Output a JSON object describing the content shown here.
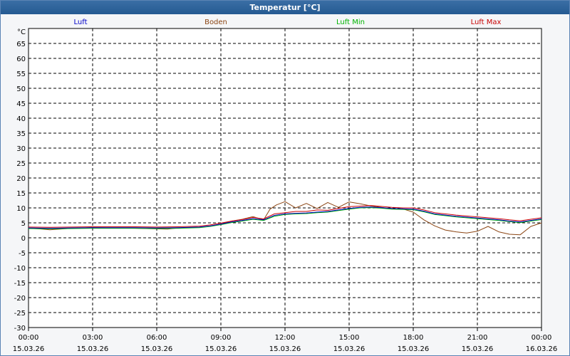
{
  "window": {
    "title": "Temperatur [°C]"
  },
  "chart_data": {
    "type": "line",
    "title": "Temperatur [°C]",
    "ylabel": "°C",
    "ylim": [
      -30,
      70
    ],
    "yticks": [
      65,
      60,
      55,
      50,
      45,
      40,
      35,
      30,
      25,
      20,
      15,
      10,
      5,
      0,
      -5,
      -10,
      -15,
      -20,
      -25,
      -30
    ],
    "xlim_hours": [
      0,
      24
    ],
    "xticks": [
      {
        "time": "00:00",
        "date": "15.03.26"
      },
      {
        "time": "03:00",
        "date": "15.03.26"
      },
      {
        "time": "06:00",
        "date": "15.03.26"
      },
      {
        "time": "09:00",
        "date": "15.03.26"
      },
      {
        "time": "12:00",
        "date": "15.03.26"
      },
      {
        "time": "15:00",
        "date": "15.03.26"
      },
      {
        "time": "18:00",
        "date": "15.03.26"
      },
      {
        "time": "21:00",
        "date": "15.03.26"
      },
      {
        "time": "00:00",
        "date": "16.03.26"
      }
    ],
    "grid": true,
    "legend_position": "top",
    "colors": {
      "Luft": "#0000c8",
      "Boden": "#8b4513",
      "Luft Min": "#00b400",
      "Luft Max": "#c80000"
    },
    "series": [
      {
        "name": "Luft",
        "x": [
          0,
          1,
          2,
          3,
          4,
          5,
          6,
          7,
          8,
          8.5,
          9,
          9.5,
          10,
          10.5,
          11,
          11.5,
          12,
          12.5,
          13,
          13.5,
          14,
          14.5,
          15,
          15.5,
          16,
          16.5,
          17,
          17.5,
          18,
          18.5,
          19,
          20,
          21,
          22,
          22.5,
          23,
          23.5,
          24
        ],
        "y": [
          3.3,
          3.2,
          3.3,
          3.4,
          3.4,
          3.4,
          3.3,
          3.4,
          3.6,
          4.0,
          4.6,
          5.3,
          5.8,
          6.4,
          6.0,
          7.5,
          8.0,
          8.2,
          8.3,
          8.6,
          8.8,
          9.3,
          9.8,
          10.2,
          10.3,
          10.1,
          9.8,
          9.7,
          9.6,
          8.9,
          8.0,
          7.2,
          6.6,
          6.0,
          5.6,
          5.3,
          5.8,
          6.3
        ]
      },
      {
        "name": "Boden",
        "x": [
          0,
          0.5,
          1,
          2,
          3,
          4,
          5,
          6,
          6.5,
          7,
          8,
          8.5,
          9,
          9.5,
          10,
          10.5,
          11,
          11.3,
          11.6,
          12,
          12.5,
          13,
          13.5,
          14,
          14.5,
          15,
          15.5,
          16,
          16.5,
          17,
          17.5,
          18,
          18.5,
          19,
          19.5,
          20,
          20.5,
          21,
          21.5,
          22,
          22.5,
          23,
          23.5,
          24
        ],
        "y": [
          3.2,
          3.0,
          2.7,
          3.2,
          3.4,
          3.3,
          3.2,
          3.0,
          2.9,
          3.3,
          3.5,
          3.9,
          4.6,
          5.6,
          6.2,
          7.1,
          6.0,
          9.6,
          11.0,
          12.1,
          10.0,
          11.5,
          9.8,
          11.8,
          10.2,
          12.0,
          11.4,
          10.7,
          10.2,
          9.7,
          9.7,
          8.6,
          6.0,
          4.0,
          2.6,
          2.0,
          1.6,
          2.2,
          3.8,
          2.0,
          1.2,
          1.0,
          3.8,
          5.0
        ]
      },
      {
        "name": "Luft Min",
        "x": [
          0,
          1,
          2,
          3,
          4,
          5,
          6,
          7,
          8,
          8.5,
          9,
          9.5,
          10,
          10.5,
          11,
          11.5,
          12,
          12.5,
          13,
          13.5,
          14,
          14.5,
          15,
          15.5,
          16,
          16.5,
          17,
          17.5,
          18,
          18.5,
          19,
          20,
          21,
          22,
          22.5,
          23,
          23.5,
          24
        ],
        "y": [
          3.1,
          3.0,
          3.1,
          3.2,
          3.2,
          3.2,
          3.1,
          3.2,
          3.4,
          3.8,
          4.4,
          5.1,
          5.6,
          6.2,
          5.8,
          7.2,
          7.8,
          8.0,
          8.1,
          8.4,
          8.6,
          9.1,
          9.6,
          10.0,
          10.1,
          9.9,
          9.6,
          9.5,
          9.4,
          8.7,
          7.8,
          7.0,
          6.4,
          5.8,
          5.4,
          5.1,
          5.6,
          6.1
        ]
      },
      {
        "name": "Luft Max",
        "x": [
          0,
          1,
          2,
          3,
          4,
          5,
          6,
          7,
          8,
          8.5,
          9,
          9.5,
          10,
          10.5,
          11,
          11.5,
          12,
          12.5,
          13,
          13.5,
          14,
          14.5,
          15,
          15.5,
          16,
          16.5,
          17,
          17.5,
          18,
          18.5,
          19,
          20,
          21,
          22,
          22.5,
          23,
          23.5,
          24
        ],
        "y": [
          3.6,
          3.5,
          3.6,
          3.7,
          3.7,
          3.7,
          3.6,
          3.7,
          3.9,
          4.3,
          4.9,
          5.6,
          6.1,
          6.8,
          6.3,
          8.0,
          8.4,
          8.8,
          8.8,
          9.3,
          9.2,
          9.8,
          10.4,
          10.6,
          10.8,
          10.5,
          10.2,
          10.0,
          10.0,
          9.3,
          8.4,
          7.6,
          7.0,
          6.4,
          6.0,
          5.7,
          6.2,
          6.7
        ]
      }
    ]
  }
}
